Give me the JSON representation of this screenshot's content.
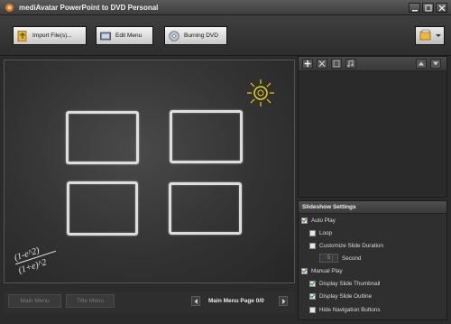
{
  "window": {
    "title": "mediAvatar PowerPoint to DVD Personal"
  },
  "toolbar": {
    "import_label": "Import File(s)...",
    "edit_menu_label": "Edit Menu",
    "burn_label": "Burning DVD"
  },
  "preview": {
    "formula_line1": "(1-e^2)",
    "formula_line2": "(1+e)^2"
  },
  "bottom": {
    "main_menu_label": "Main Menu",
    "title_menu_label": "Title Menu",
    "page_label": "Main Menu Page 0/0"
  },
  "settings": {
    "title": "Slideshow Settings",
    "options": [
      {
        "label": "Auto Play",
        "checked": true
      },
      {
        "label": "Loop",
        "checked": false
      },
      {
        "label": "Customize Slide Duration",
        "checked": false
      },
      {
        "label": "Manual Play",
        "checked": true
      },
      {
        "label": "Display Slide Thumbnail",
        "checked": true
      },
      {
        "label": "Display Slide Outline",
        "checked": true
      },
      {
        "label": "Hide Navigation Buttons",
        "checked": false
      }
    ],
    "duration_value": "5",
    "duration_unit": "Second"
  },
  "colors": {
    "accent_orange": "#e07a1f",
    "check_green": "#1d8f1d",
    "chalk": "#ebebeb",
    "sun_yellow": "#f2d300"
  }
}
